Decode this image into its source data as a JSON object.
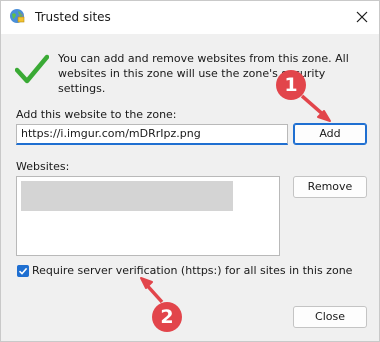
{
  "window": {
    "title": "Trusted sites"
  },
  "info": {
    "text": "You can add and remove websites from this zone. All websites in this zone will use the zone's security settings."
  },
  "add_section": {
    "label": "Add this website to the zone:",
    "input_value": "https://i.imgur.com/mDRrIpz.png",
    "add_button": "Add"
  },
  "websites": {
    "label": "Websites:",
    "remove_button": "Remove"
  },
  "verification": {
    "label": "Require server verification (https:) for all sites in this zone",
    "checked": true
  },
  "footer": {
    "close_button": "Close"
  },
  "annotations": {
    "badge_1": "1",
    "badge_2": "2"
  },
  "colors": {
    "accent": "#1f6fd1",
    "annotation": "#e2454b",
    "check": "#3aaa35"
  },
  "icons": [
    "globe-icon",
    "close-icon",
    "checkmark-icon",
    "checkbox-check-icon",
    "arrow-icon"
  ]
}
